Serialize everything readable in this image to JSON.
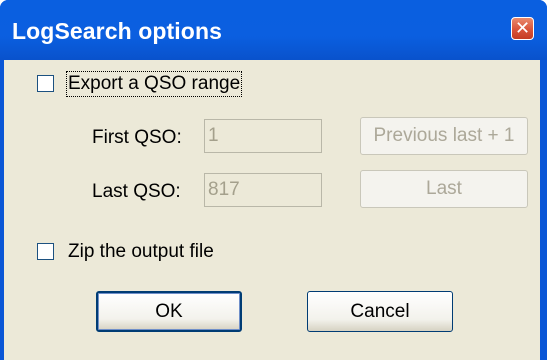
{
  "window": {
    "title": "LogSearch options",
    "close_glyph": "✕"
  },
  "export_range": {
    "label": "Export a QSO range",
    "checked": false
  },
  "first_qso": {
    "label": "First QSO:",
    "value": "1"
  },
  "last_qso": {
    "label": "Last QSO:",
    "value": "817"
  },
  "buttons": {
    "previous_last": "Previous last + 1",
    "last": "Last",
    "ok": "OK",
    "cancel": "Cancel"
  },
  "zip": {
    "label": "Zip the output file",
    "checked": false
  },
  "colors": {
    "title_bar": "#0a5fe0",
    "dialog_bg": "#ece9d8",
    "close_button": "#d9533a"
  }
}
